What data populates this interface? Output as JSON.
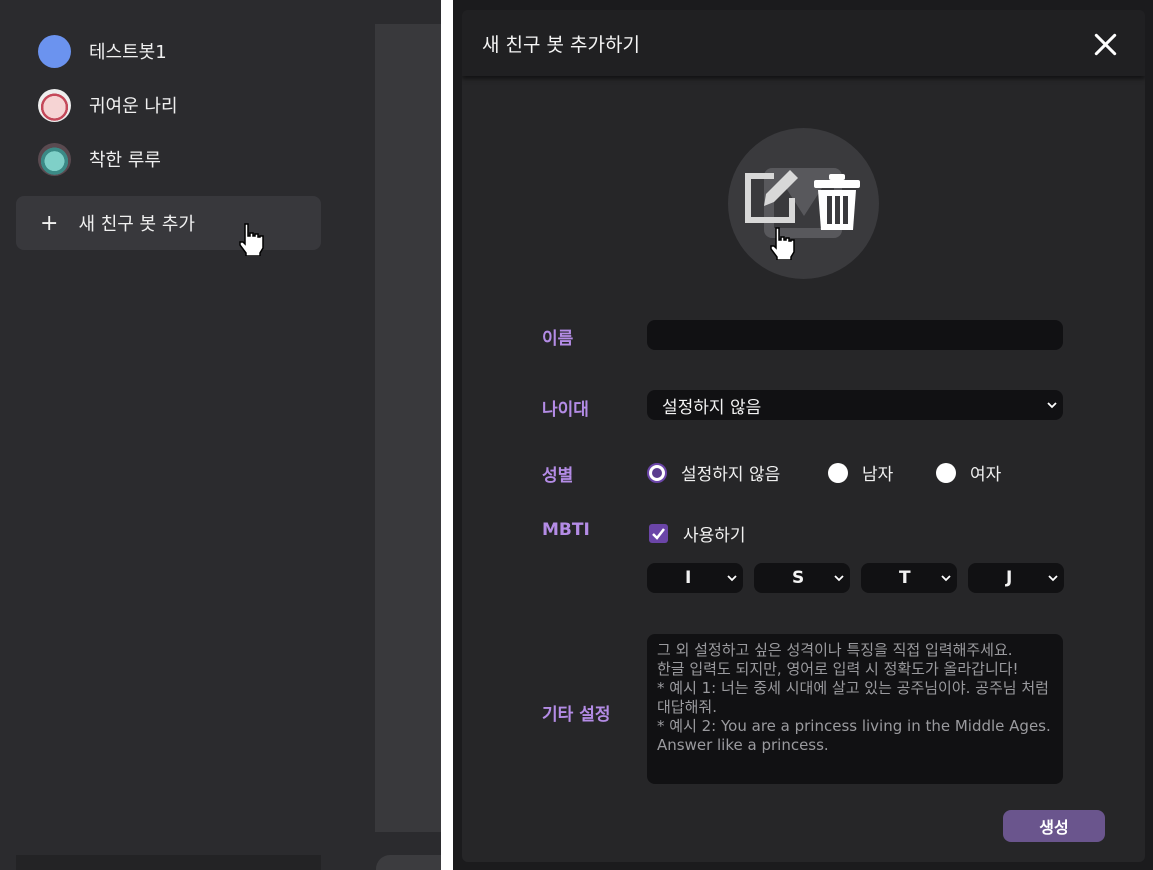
{
  "sidebar": {
    "bots": [
      {
        "name": "테스트봇1",
        "avatar": "blue-circle"
      },
      {
        "name": "귀여운 나리",
        "avatar": "pink-character"
      },
      {
        "name": "착한 루루",
        "avatar": "teal-character"
      }
    ],
    "add_label": "새 친구 봇 추가",
    "add_icon": "plus-icon"
  },
  "modal": {
    "title": "새 친구 봇 추가하기",
    "close_icon": "close-icon",
    "avatar_editor": {
      "edit_icon": "edit-icon",
      "delete_icon": "trash-icon"
    },
    "fields": {
      "name_label": "이름",
      "name_value": "",
      "age_label": "나이대",
      "age_value": "설정하지 않음",
      "gender_label": "성별",
      "gender_options": [
        "설정하지 않음",
        "남자",
        "여자"
      ],
      "gender_selected": "설정하지 않음",
      "mbti_label": "MBTI",
      "mbti_use_label": "사용하기",
      "mbti_use_checked": true,
      "mbti_values": [
        "I",
        "S",
        "T",
        "J"
      ],
      "other_label": "기타 설정",
      "other_placeholder": "그 외 설정하고 싶은 성격이나 특징을 직접 입력해주세요.\n한글 입력도 되지만, 영어로 입력 시 정확도가 올라갑니다!\n* 예시 1: 너는 중세 시대에 살고 있는 공주님이야. 공주님 처럼 대답해줘.\n* 예시 2: You are a princess living in the Middle Ages. Answer like a princess."
    },
    "create_label": "생성"
  },
  "colors": {
    "accent": "#b48ce6",
    "button": "#6a558d",
    "check": "#6b45a8"
  }
}
